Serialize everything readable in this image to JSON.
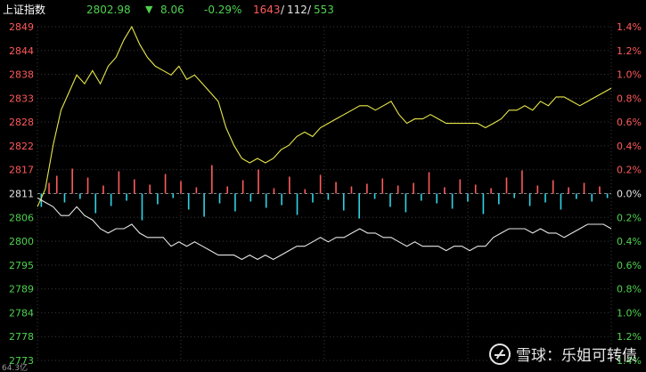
{
  "header": {
    "index_name": "上证指数",
    "price": "2802.98",
    "change_arrow": "▼",
    "change": "8.06",
    "change_pct": "-0.29%",
    "up_count": "1643",
    "flat_count": "112",
    "down_count": "553",
    "sep": "/"
  },
  "watermark": {
    "text": "雪球：乐姐可转债"
  },
  "colors": {
    "up": "#ff5a5a",
    "down": "#2ed3e6",
    "flat": "#e6e6e6",
    "green_text": "#4fd14f",
    "yellow_line": "#e8e84a",
    "white_line": "#e6e6e6",
    "grid": "#3a3a3a"
  },
  "chart_data": {
    "type": "line",
    "y_left_ticks": [
      "2849",
      "2844",
      "2838",
      "2833",
      "2828",
      "2822",
      "2817",
      "2811",
      "2806",
      "2800",
      "2795",
      "2789",
      "2784",
      "2778",
      "2773"
    ],
    "y_right_ticks": [
      "1.4%",
      "1.2%",
      "1.0%",
      "0.8%",
      "0.6%",
      "0.4%",
      "0.2%",
      "0.0%",
      "0.2%",
      "0.4%",
      "0.6%",
      "0.8%",
      "1.0%",
      "1.2%",
      "1.4%"
    ],
    "ylim": [
      2773,
      2849
    ],
    "baseline": 2811,
    "x_bottom_label": "64.3亿",
    "series": [
      {
        "values": [
          2808,
          2812,
          2822,
          2830,
          2834,
          2838,
          2836,
          2839,
          2836,
          2840,
          2842,
          2846,
          2849,
          2845,
          2842,
          2840,
          2839,
          2838,
          2840,
          2837,
          2838,
          2836,
          2834,
          2832,
          2826,
          2822,
          2819,
          2818,
          2819,
          2818,
          2819,
          2821,
          2822,
          2824,
          2825,
          2824,
          2826,
          2827,
          2828,
          2829,
          2830,
          2831,
          2831,
          2830,
          2831,
          2832,
          2829,
          2827,
          2828,
          2828,
          2829,
          2828,
          2827,
          2827,
          2827,
          2827,
          2827,
          2826,
          2827,
          2828,
          2830,
          2830,
          2831,
          2830,
          2832,
          2831,
          2833,
          2833,
          2832,
          2831,
          2832,
          2833,
          2834,
          2835
        ]
      },
      {
        "values": [
          2810,
          2809,
          2808,
          2806,
          2806,
          2808,
          2806,
          2805,
          2803,
          2802,
          2803,
          2803,
          2804,
          2802,
          2801,
          2801,
          2801,
          2799,
          2800,
          2799,
          2800,
          2799,
          2798,
          2797,
          2797,
          2797,
          2796,
          2797,
          2796,
          2797,
          2796,
          2797,
          2798,
          2799,
          2799,
          2800,
          2801,
          2800,
          2801,
          2801,
          2802,
          2803,
          2802,
          2802,
          2801,
          2801,
          2800,
          2799,
          2800,
          2799,
          2799,
          2799,
          2798,
          2799,
          2799,
          2798,
          2799,
          2799,
          2801,
          2802,
          2803,
          2803,
          2803,
          2802,
          2803,
          2802,
          2802,
          2801,
          2802,
          2803,
          2804,
          2804,
          2804,
          2803
        ]
      }
    ],
    "volume_bars": [
      -1.5,
      1.2,
      2.0,
      -1.0,
      2.8,
      -0.6,
      1.8,
      -2.2,
      0.9,
      -1.4,
      2.5,
      -0.8,
      1.6,
      -3.0,
      1.0,
      -1.2,
      2.2,
      -0.5,
      1.4,
      -1.8,
      0.7,
      -2.6,
      3.2,
      -1.1,
      0.8,
      -2.0,
      1.5,
      -0.9,
      2.7,
      -1.6,
      0.6,
      -1.3,
      1.9,
      -2.4,
      0.5,
      -1.0,
      2.1,
      -0.7,
      1.3,
      -1.9,
      0.8,
      -2.8,
      1.1,
      -0.6,
      1.7,
      -1.5,
      0.9,
      -2.1,
      1.2,
      -0.8,
      2.4,
      -1.1,
      0.7,
      -1.7,
      1.6,
      -0.9,
      1.0,
      -2.3,
      0.6,
      -1.2,
      1.8,
      -0.5,
      2.6,
      -1.4,
      0.9,
      -1.0,
      1.5,
      -1.8,
      0.7,
      -0.6,
      1.2,
      -0.9,
      0.8,
      -0.5
    ]
  }
}
